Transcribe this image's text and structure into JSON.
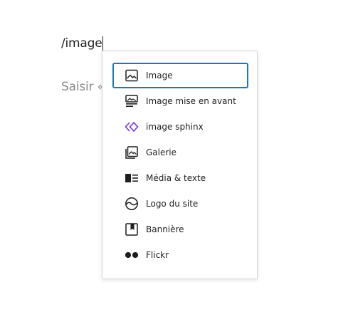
{
  "editor": {
    "typed_text": "/image",
    "placeholder_text": "Saisir «"
  },
  "inserter": {
    "items": [
      {
        "label": "Image",
        "icon": "image-icon",
        "selected": true
      },
      {
        "label": "Image mise en avant",
        "icon": "featured-image-icon",
        "selected": false
      },
      {
        "label": "image sphinx",
        "icon": "sphinx-block-icon",
        "selected": false
      },
      {
        "label": "Galerie",
        "icon": "gallery-icon",
        "selected": false
      },
      {
        "label": "Média & texte",
        "icon": "media-text-icon",
        "selected": false
      },
      {
        "label": "Logo du site",
        "icon": "site-logo-icon",
        "selected": false
      },
      {
        "label": "Bannière",
        "icon": "cover-icon",
        "selected": false
      },
      {
        "label": "Flickr",
        "icon": "flickr-icon",
        "selected": false
      }
    ]
  },
  "colors": {
    "focus_border": "#1a79b8",
    "sphinx_icon": "#7a2ed6",
    "text": "#1e1e1e"
  }
}
